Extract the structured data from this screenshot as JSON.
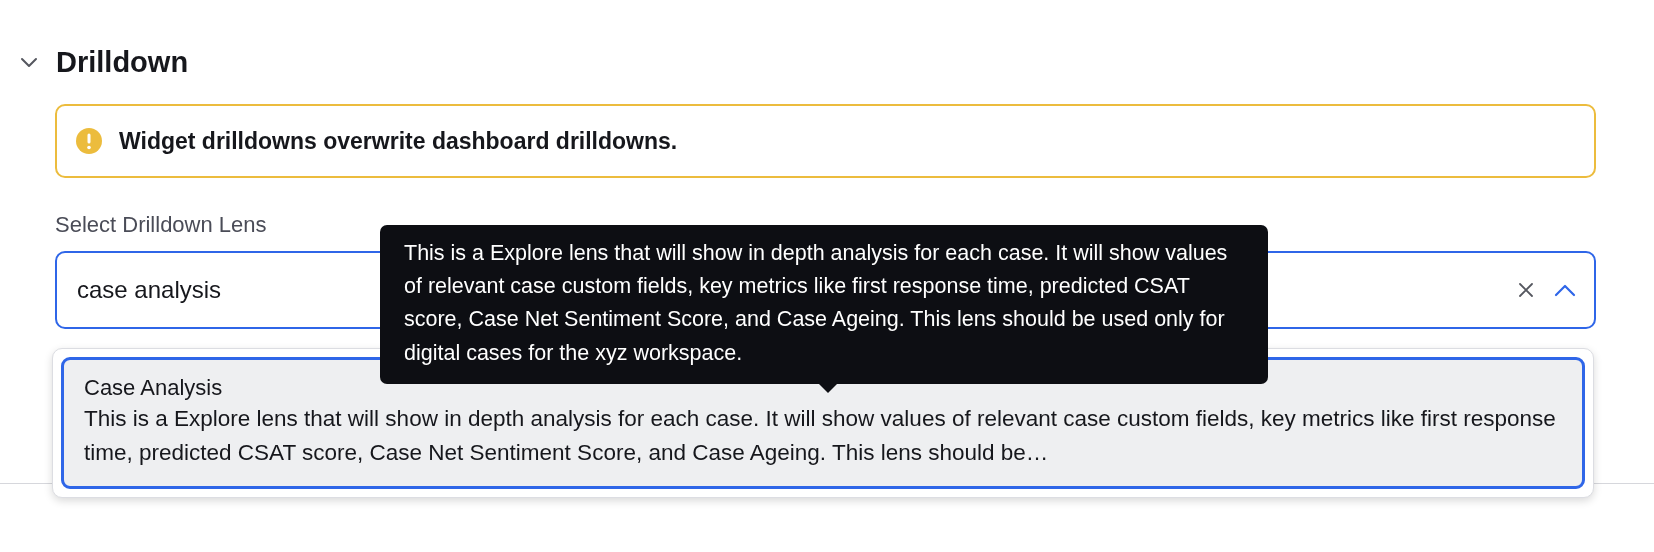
{
  "section": {
    "title": "Drilldown",
    "expanded": true
  },
  "alert": {
    "text": "Widget drilldowns overwrite dashboard drilldowns."
  },
  "lens_select": {
    "label": "Select Drilldown Lens",
    "value": "case analysis",
    "open": true
  },
  "options": [
    {
      "title": "Case Analysis",
      "description": "This is a Explore lens that will show in depth analysis for each case. It will show values of relevant case custom fields, key metrics like first response time, predicted CSAT score, Case Net Sentiment Score, and Case Ageing. This lens should be…",
      "selected": true
    }
  ],
  "tooltip": {
    "text": "This is a Explore lens that will show in depth analysis for each case. It will show values of relevant case custom fields, key metrics like first response time, predicted CSAT score, Case Net Sentiment Score, and Case Ageing. This lens should be used only for digital cases for the xyz workspace."
  }
}
